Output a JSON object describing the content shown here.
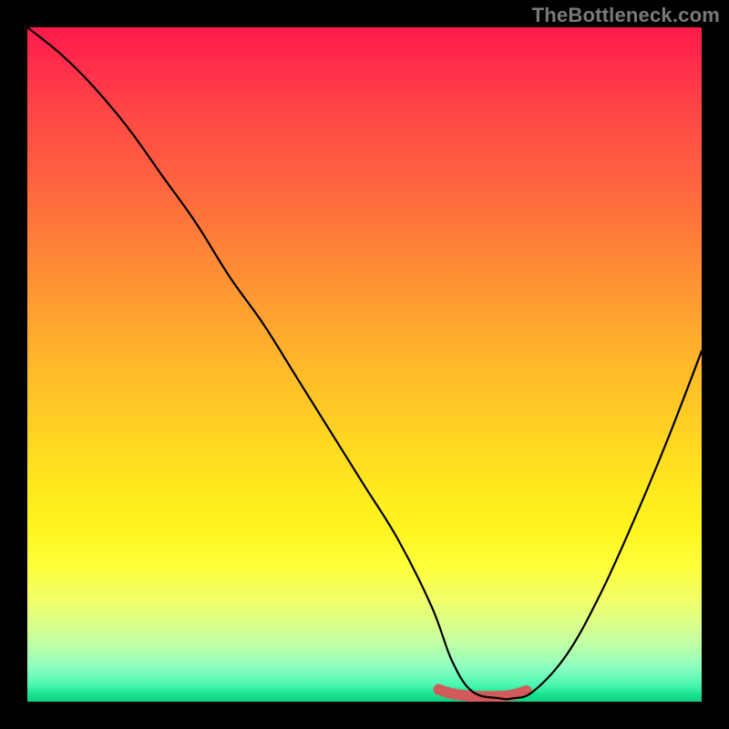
{
  "watermark": "TheBottleneck.com",
  "colors": {
    "background": "#000000",
    "watermark_text": "#7a7a7a",
    "curve": "#000000",
    "highlight": "#d25a5a",
    "gradient_top": "#ff1a4b",
    "gradient_bottom": "#0fd182"
  },
  "chart_data": {
    "type": "line",
    "title": "",
    "xlabel": "",
    "ylabel": "",
    "xlim": [
      0,
      100
    ],
    "ylim": [
      0,
      100
    ],
    "grid": false,
    "legend": false,
    "annotations": [
      "TheBottleneck.com"
    ],
    "series": [
      {
        "name": "bottleneck-curve",
        "x": [
          0,
          5,
          10,
          15,
          20,
          25,
          30,
          35,
          40,
          45,
          50,
          55,
          60,
          63,
          66,
          70,
          72,
          75,
          80,
          85,
          90,
          95,
          100
        ],
        "values": [
          100,
          96,
          91,
          85,
          78,
          71,
          63,
          56,
          48,
          40,
          32,
          24,
          14,
          6,
          1.5,
          0.5,
          0.5,
          1.5,
          7,
          16,
          27,
          39,
          52
        ]
      },
      {
        "name": "optimal-range-highlight",
        "x": [
          61,
          63,
          66,
          70,
          72,
          74
        ],
        "values": [
          1.8,
          1.2,
          0.8,
          0.8,
          1.0,
          1.6
        ]
      }
    ]
  }
}
